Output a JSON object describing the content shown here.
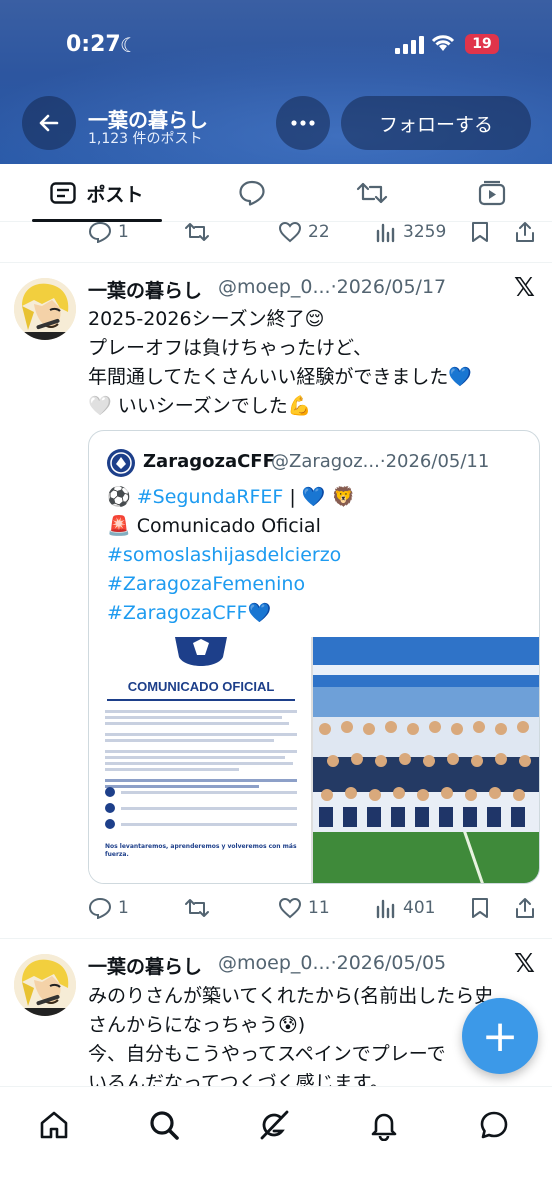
{
  "status_bar": {
    "time": "0:27",
    "battery": "19"
  },
  "header": {
    "title": "一葉の暮らし",
    "post_count": "1,123 件のポスト",
    "follow_label": "フォローする"
  },
  "tabs": [
    {
      "label": "ポスト",
      "icon": "posts-icon",
      "selected": true
    },
    {
      "label": "",
      "icon": "replies-icon"
    },
    {
      "label": "",
      "icon": "reposts-icon"
    },
    {
      "label": "",
      "icon": "video-icon"
    }
  ],
  "prev_post_actions": {
    "replies": "1",
    "likes": "22",
    "views": "3259"
  },
  "post1": {
    "name": "一葉の暮らし",
    "meta": "@moep_0...·2026/05/17",
    "lines": [
      "2025-2026シーズン終了😌",
      "プレーオフは負けちゃったけど、",
      "年間通してたくさんいい経験ができました💙",
      "🤍 いいシーズンでした💪"
    ],
    "quote": {
      "name": "ZaragozaCFF",
      "meta": "@Zaragoz...·2026/05/11",
      "line1_icon": "⚽️",
      "line1_tag": "#SegundaRFEF",
      "line1_tail": " | 💙 🦁",
      "line2": "🚨 Comunicado Oficial",
      "tags": [
        "#somoslashijasdelcierzo",
        "#ZaragozaFemenino",
        "#ZaragozaCFF💙"
      ],
      "doc_heading": "COMUNICADO OFICIAL",
      "doc_footer": "Nos levantaremos, aprenderemos y volveremos con más fuerza."
    },
    "actions": {
      "replies": "1",
      "likes": "11",
      "views": "401"
    }
  },
  "post2": {
    "name": "一葉の暮らし",
    "meta": "@moep_0...·2026/05/05",
    "lines": [
      "みのりさんが築いてくれたから(名前出したら史",
      "さんからになっちゃう😰)",
      "今、自分もこうやってスペインでプレーで",
      "いるんだなってつくづく感じます。"
    ]
  },
  "fab_label": "+",
  "nav": [
    "home-icon",
    "search-icon",
    "grok-icon",
    "notifications-icon",
    "messages-icon"
  ]
}
